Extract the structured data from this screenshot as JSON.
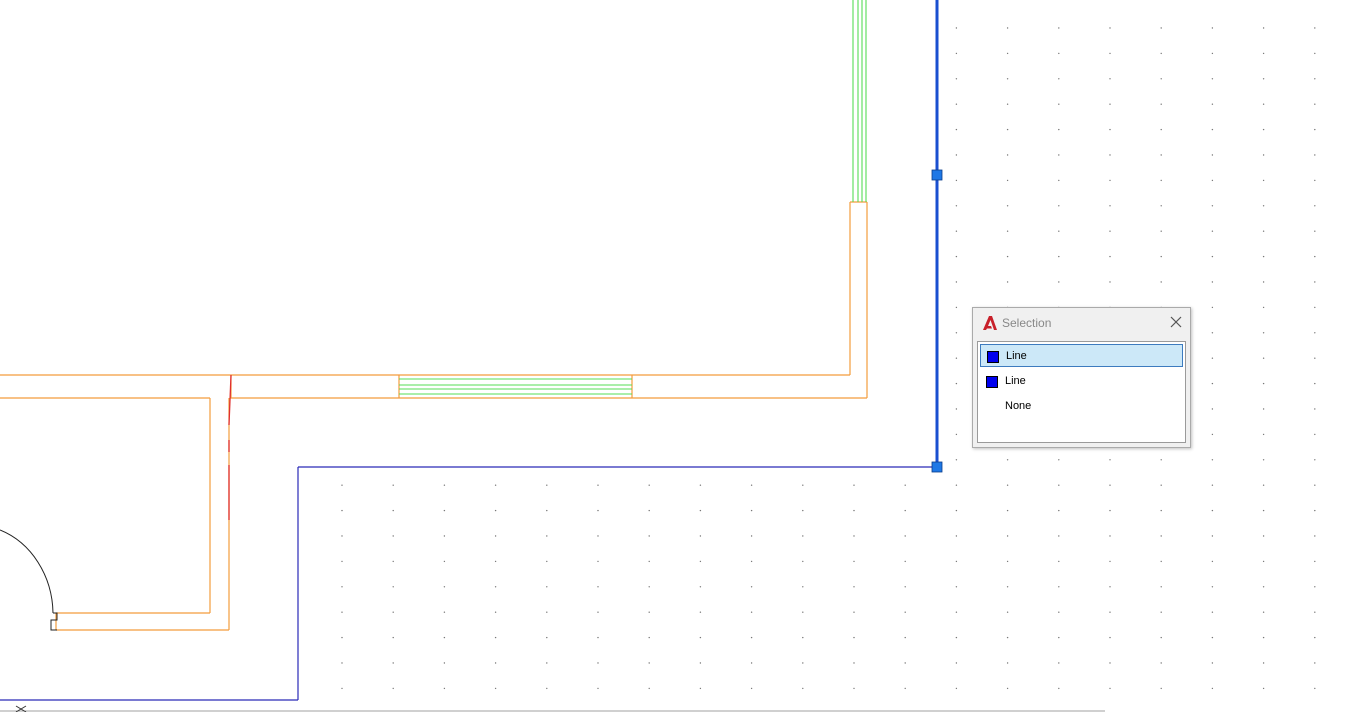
{
  "selection_popup": {
    "title": "Selection",
    "logo_icon": "autocad-logo-icon",
    "close_icon": "close-icon",
    "items": [
      {
        "label": "Line",
        "swatch_color": "#0000ee",
        "selected": true
      },
      {
        "label": "Line",
        "swatch_color": "#0000ee",
        "selected": false
      },
      {
        "label": "None",
        "swatch_color": null,
        "selected": false
      }
    ]
  },
  "canvas": {
    "background": "#ffffff",
    "grid_dots": true,
    "colors": {
      "wall_orange": "#f39c3c",
      "window_green": "#55dd55",
      "selected_line": "#1a4fd0",
      "boundary_blue": "#2a2ab8",
      "grip": "#1e78e6",
      "red_line": "#e03030",
      "door_arc": "#222222",
      "grid_dot": "#777777"
    }
  }
}
